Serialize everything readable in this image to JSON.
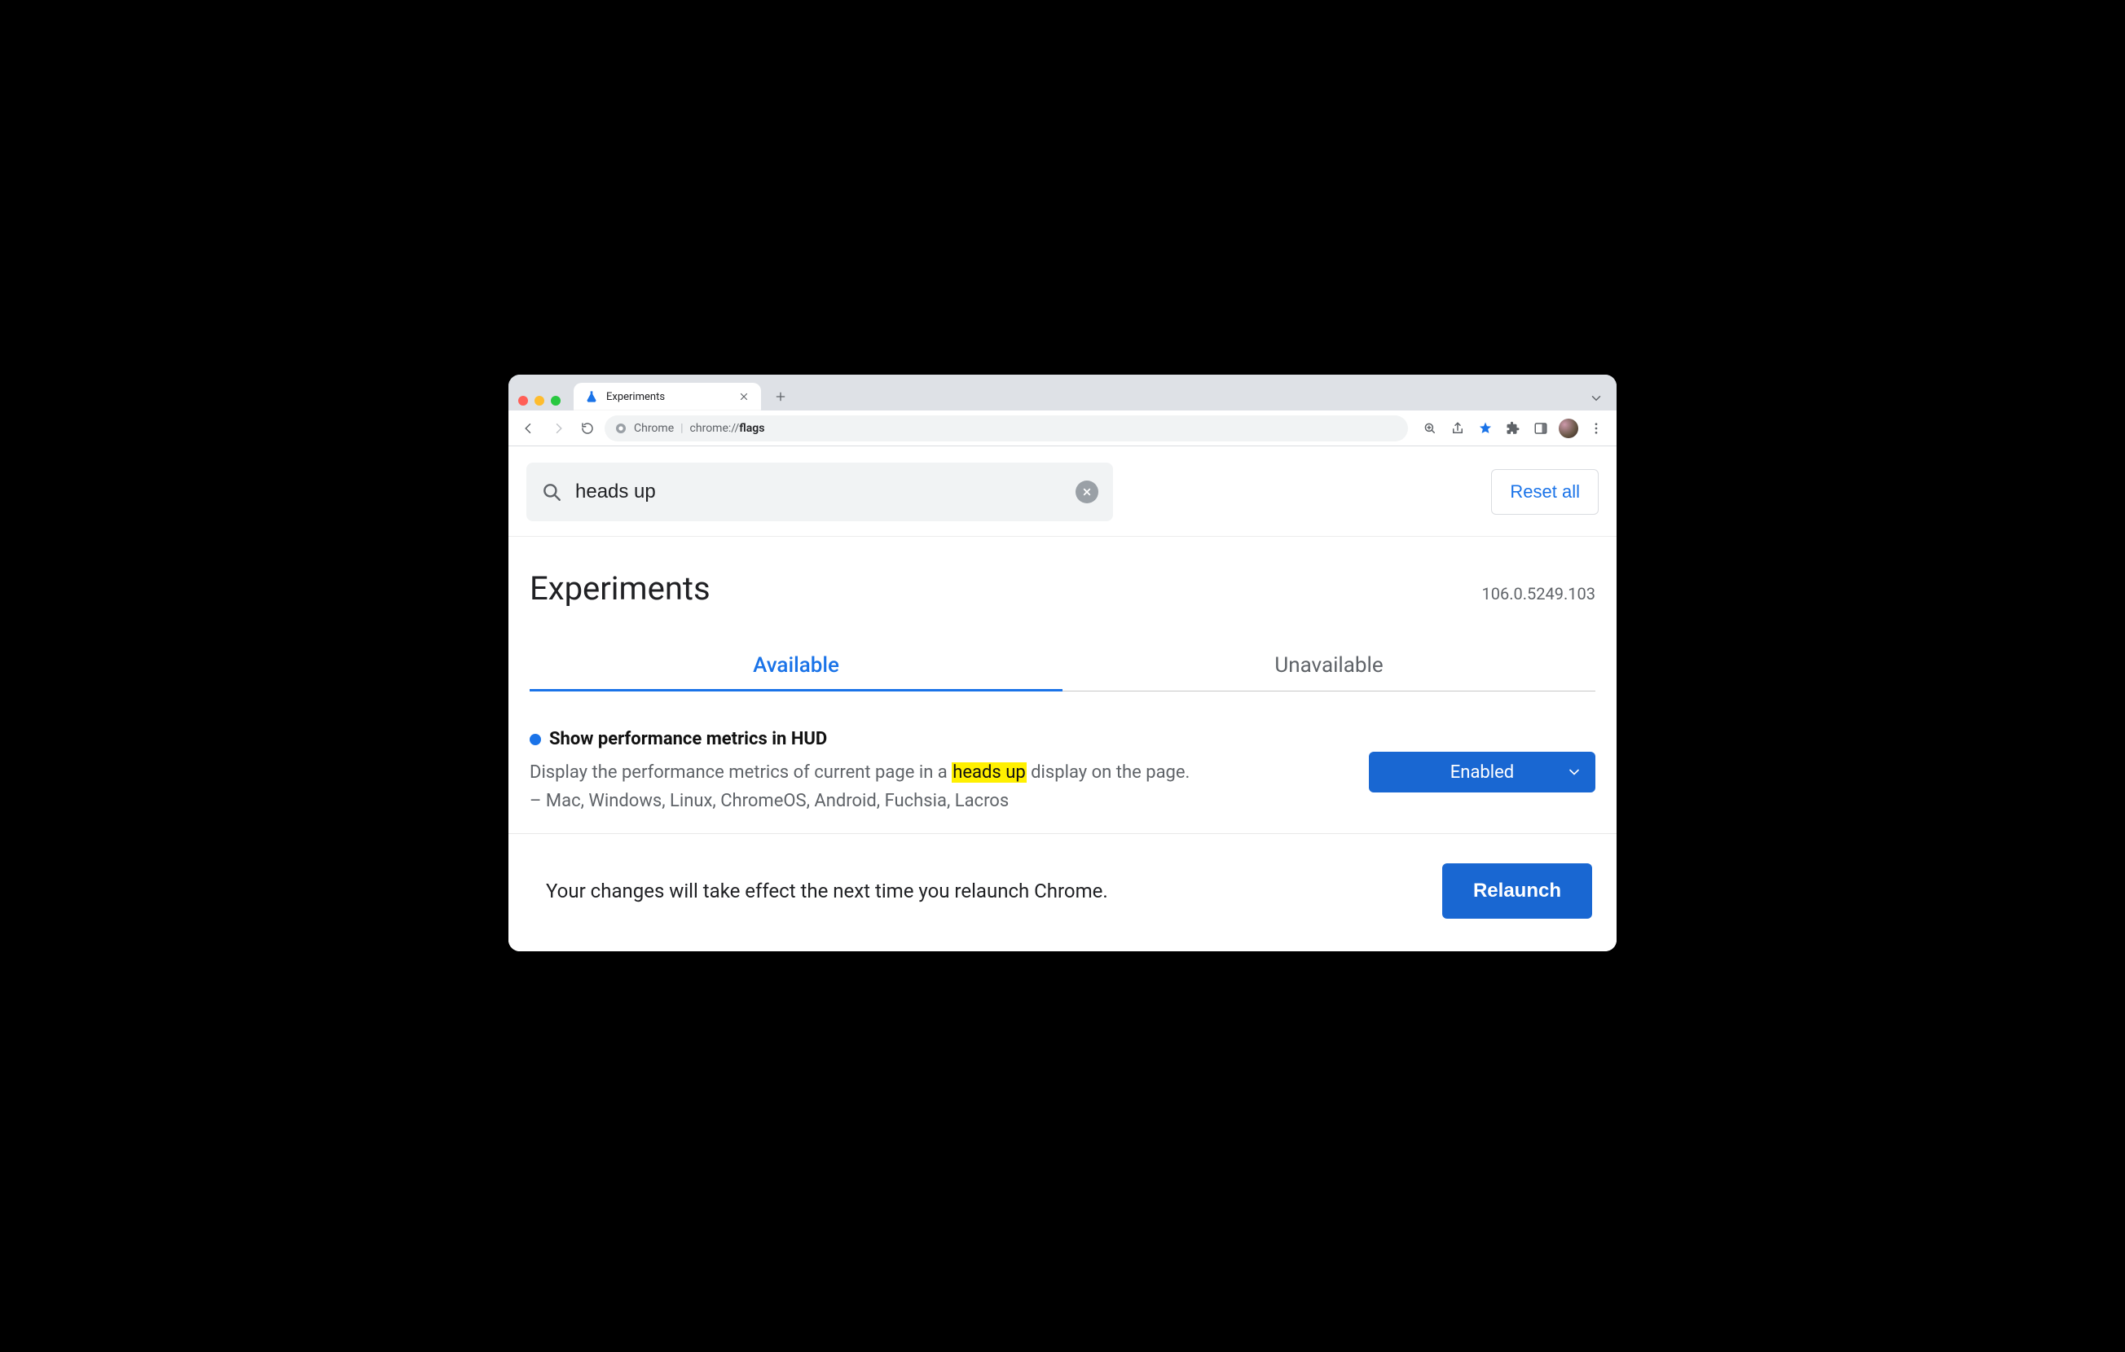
{
  "browser": {
    "tab_title": "Experiments",
    "url_prefix": "Chrome",
    "url_scheme": "chrome://",
    "url_path": "flags"
  },
  "search": {
    "value": "heads up",
    "reset_label": "Reset all"
  },
  "header": {
    "title": "Experiments",
    "version": "106.0.5249.103"
  },
  "tabs": {
    "available": "Available",
    "unavailable": "Unavailable"
  },
  "flag": {
    "title": "Show performance metrics in HUD",
    "desc_pre": "Display the performance metrics of current page in a ",
    "desc_hl": "heads up",
    "desc_post": " display on the page. – Mac, Windows, Linux, ChromeOS, Android, Fuchsia, Lacros",
    "select_value": "Enabled"
  },
  "footer": {
    "message": "Your changes will take effect the next time you relaunch Chrome.",
    "relaunch": "Relaunch"
  }
}
